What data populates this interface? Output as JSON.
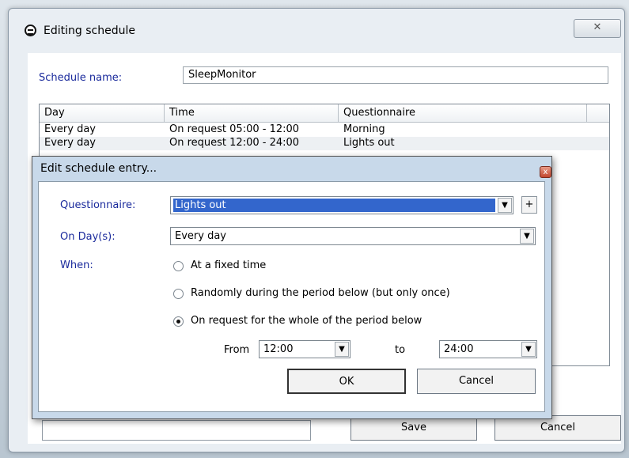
{
  "outer_window": {
    "title": "Editing schedule",
    "close_glyph": "✕",
    "schedule_name_label": "Schedule name:",
    "schedule_name_value": "SleepMonitor",
    "list": {
      "columns": [
        "Day",
        "Time",
        "Questionnaire"
      ],
      "rows": [
        [
          "Every day",
          "On request 05:00 - 12:00",
          "Morning"
        ],
        [
          "Every day",
          "On request 12:00 - 24:00",
          "Lights out"
        ]
      ]
    },
    "save_label": "Save",
    "cancel_label": "Cancel"
  },
  "dialog": {
    "title": "Edit schedule entry...",
    "close_glyph": "x",
    "questionnaire_label": "Questionnaire:",
    "questionnaire_value": "Lights out",
    "add_glyph": "+",
    "days_label": "On Day(s):",
    "days_value": "Every day",
    "when_label": "When:",
    "options": [
      {
        "label": "At a fixed time",
        "selected": false
      },
      {
        "label": "Randomly during the period below (but only once)",
        "selected": false
      },
      {
        "label": "On request for the whole of the period below",
        "selected": true
      }
    ],
    "from_label": "From",
    "from_value": "12:00",
    "to_label": "to",
    "to_value": "24:00",
    "ok_label": "OK",
    "cancel_label": "Cancel"
  },
  "icons": {
    "app": "app-icon",
    "dropdown": "chevron-down-icon"
  },
  "colors": {
    "label_blue": "#1a2a9c",
    "selection": "#3366cc",
    "dialog_frame": "#c8d9ea"
  }
}
